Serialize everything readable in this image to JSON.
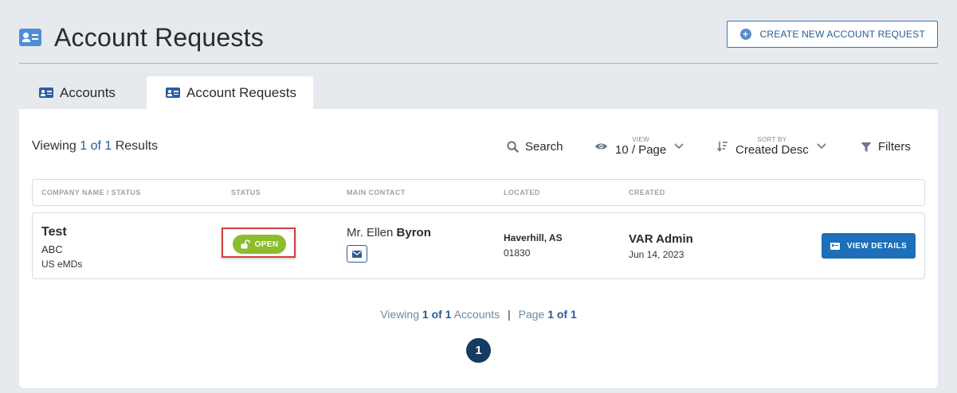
{
  "header": {
    "title": "Account Requests",
    "create_button": "CREATE NEW ACCOUNT REQUEST"
  },
  "tabs": [
    {
      "label": "Accounts",
      "active": false
    },
    {
      "label": "Account Requests",
      "active": true
    }
  ],
  "results": {
    "prefix": "Viewing",
    "current": "1",
    "of": "of",
    "total": "1",
    "suffix": "Results"
  },
  "toolbar": {
    "search_label": "Search",
    "view_label": "VIEW",
    "view_value": "10 / Page",
    "sort_label": "SORT BY",
    "sort_value": "Created Desc",
    "filters_label": "Filters"
  },
  "table": {
    "columns": [
      "COMPANY NAME / STATUS",
      "STATUS",
      "MAIN CONTACT",
      "LOCATED",
      "CREATED"
    ],
    "rows": [
      {
        "company": "Test",
        "company_line2": "ABC",
        "company_line3": "US eMDs",
        "status": "OPEN",
        "contact_prefix": "Mr. Ellen",
        "contact_last": "Byron",
        "city": "Haverhill, AS",
        "zip": "01830",
        "created_by": "VAR Admin",
        "created_date": "Jun 14, 2023",
        "action": "VIEW DETAILS"
      }
    ]
  },
  "footer": {
    "viewing": "Viewing",
    "range": "1 of 1",
    "accounts": "Accounts",
    "page_word": "Page",
    "page_range": "1 of 1",
    "current_page": "1"
  },
  "colors": {
    "accent": "#1c6fb8",
    "status_open": "#8cbc2c",
    "highlight_box": "#d43c3c",
    "page_dot": "#153b63"
  }
}
